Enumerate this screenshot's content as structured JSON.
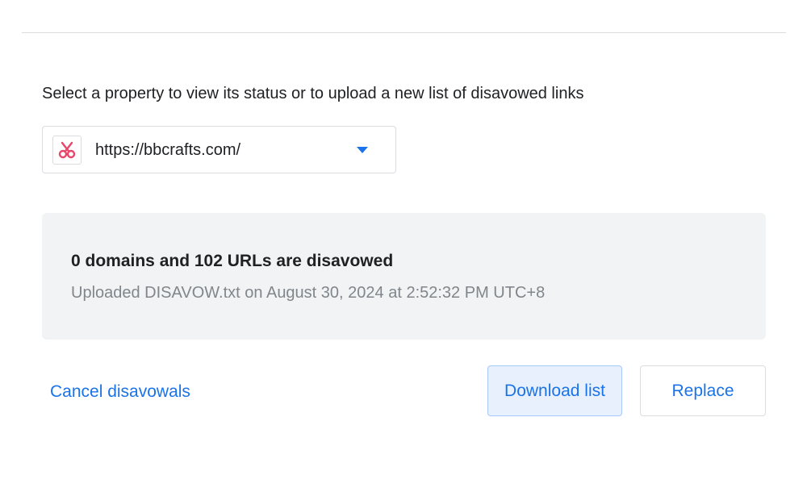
{
  "instruction": "Select a property to view its status or to upload a new list of disavowed links",
  "property_select": {
    "favicon": "scissors-icon",
    "selected_value": "https://bbcrafts.com/",
    "arrow": "dropdown-arrow-icon"
  },
  "status": {
    "heading": "0 domains and 102 URLs are disavowed",
    "subtext": "Uploaded DISAVOW.txt on August 30, 2024 at 2:52:32 PM UTC+8"
  },
  "actions": {
    "cancel_label": "Cancel disavowals",
    "download_label": "Download list",
    "replace_label": "Replace"
  },
  "colors": {
    "accent": "#1a73e8",
    "panel_bg": "#f1f3f4",
    "favicon": "#e8476a"
  }
}
